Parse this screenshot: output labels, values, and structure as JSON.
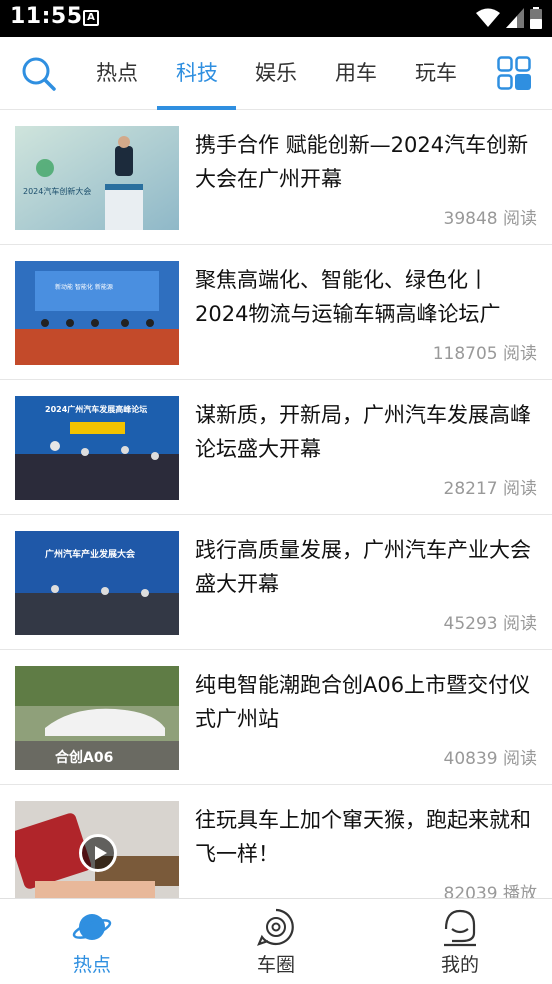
{
  "status_bar": {
    "time": "11:55",
    "notification_glyph": "A"
  },
  "top_nav": {
    "tabs": [
      {
        "label": "热点",
        "active": false
      },
      {
        "label": "科技",
        "active": true
      },
      {
        "label": "娱乐",
        "active": false
      },
      {
        "label": "用车",
        "active": false
      },
      {
        "label": "玩车",
        "active": false
      }
    ],
    "accent_color": "#2f8fe0"
  },
  "feed": {
    "items": [
      {
        "title": "携手合作 赋能创新—2024汽车创新大会在广州开幕",
        "stat": "39848 阅读",
        "video": false
      },
      {
        "title": "聚焦高端化、智能化、绿色化丨2024物流与运输车辆高峰论坛广",
        "stat": "118705 阅读",
        "video": false
      },
      {
        "title": "谋新质，开新局，广州汽车发展高峰论坛盛大开幕",
        "stat": "28217 阅读",
        "video": false
      },
      {
        "title": "践行高质量发展，广州汽车产业大会盛大开幕",
        "stat": "45293 阅读",
        "video": false
      },
      {
        "title": "纯电智能潮跑合创A06上市暨交付仪式广州站",
        "stat": "40839 阅读",
        "video": false
      },
      {
        "title": "往玩具车上加个窜天猴，跑起来就和飞一样！",
        "stat": "82039 播放",
        "video": true
      }
    ],
    "thumb_captions": [
      "2024汽车创新大会",
      "新动能 智能化 新能源",
      "2024广州汽车发展高峰论坛",
      "广州汽车产业发展大会",
      "合创A06"
    ]
  },
  "bottom_nav": {
    "items": [
      {
        "label": "热点",
        "active": true
      },
      {
        "label": "车圈",
        "active": false
      },
      {
        "label": "我的",
        "active": false
      }
    ]
  }
}
